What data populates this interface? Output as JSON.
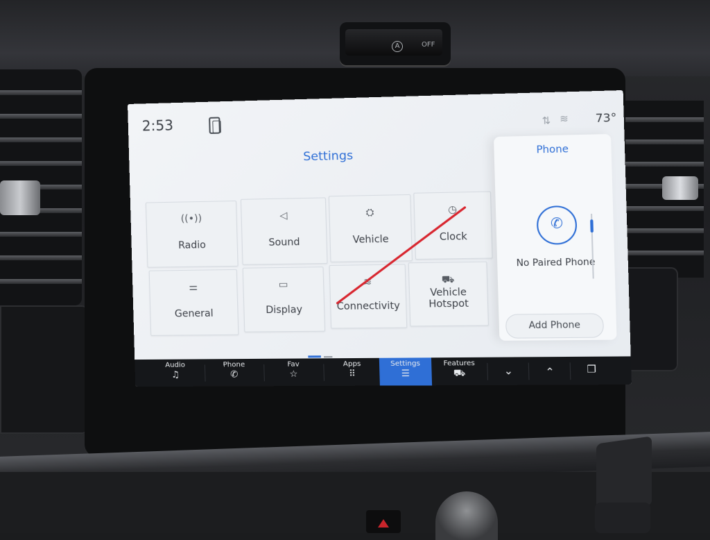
{
  "status_bar": {
    "time": "2:53",
    "temperature": "73°",
    "icons": [
      "phone-projection-icon",
      "signal-icon",
      "wifi-icon"
    ]
  },
  "settings": {
    "title": "Settings",
    "tiles": [
      {
        "label": "Radio",
        "icon": "radio-antenna-icon"
      },
      {
        "label": "Sound",
        "icon": "speaker-icon"
      },
      {
        "label": "Vehicle",
        "icon": "vehicle-settings-icon"
      },
      {
        "label": "Clock",
        "icon": "clock-icon"
      },
      {
        "label": "General",
        "icon": "sliders-icon"
      },
      {
        "label": "Display",
        "icon": "display-icon"
      },
      {
        "label": "Connectivity",
        "icon": "wifi-icon"
      },
      {
        "label": "Vehicle Hotspot",
        "icon": "car-wifi-icon"
      }
    ]
  },
  "phone_panel": {
    "title": "Phone",
    "status": "No Paired Phone",
    "add_button": "Add Phone"
  },
  "nav": {
    "items": [
      {
        "label": "Audio",
        "icon": "music-note-icon",
        "glyph": "♫"
      },
      {
        "label": "Phone",
        "icon": "phone-icon",
        "glyph": "✆"
      },
      {
        "label": "Fav",
        "icon": "star-icon",
        "glyph": "☆"
      },
      {
        "label": "Apps",
        "icon": "apps-grid-icon",
        "glyph": "⠿"
      },
      {
        "label": "Settings",
        "icon": "sliders-icon",
        "glyph": "☰",
        "active": true
      },
      {
        "label": "Features",
        "icon": "car-icon",
        "glyph": "⛟"
      }
    ],
    "controls": [
      "chevron-down-icon",
      "chevron-up-icon",
      "screens-icon"
    ]
  },
  "dashboard": {
    "hazard_off_label": "OFF"
  },
  "colors": {
    "accent": "#2f6fd6",
    "nav_bg": "#15171a",
    "screen_bg": "#eef1f4",
    "annotation_line": "#d8262f"
  }
}
